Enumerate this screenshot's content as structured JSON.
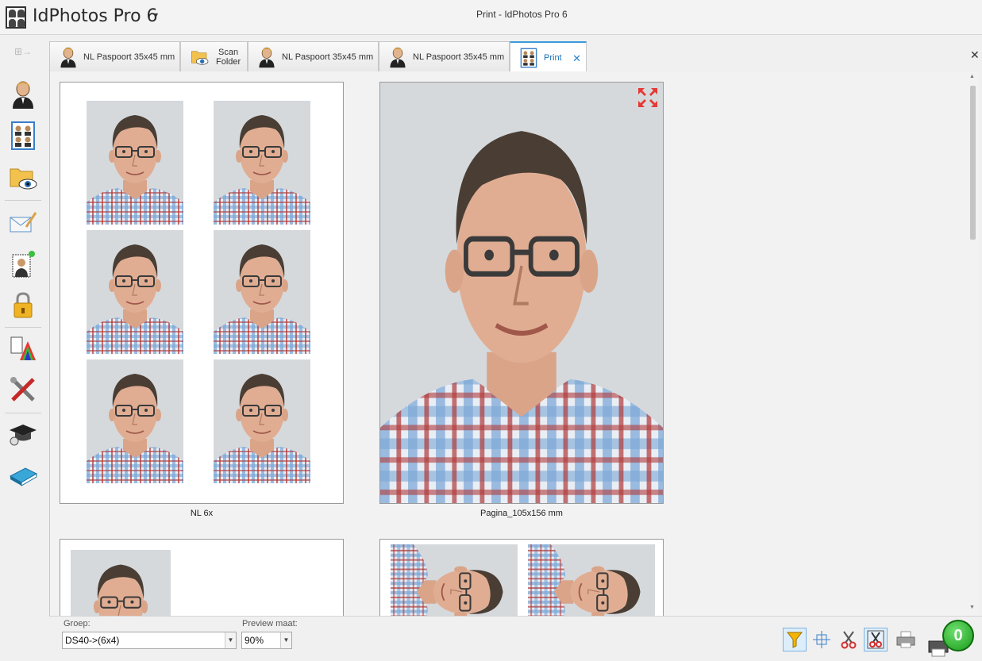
{
  "app": {
    "name": "IdPhotos Pro 6",
    "window_title": "Print - IdPhotos Pro 6"
  },
  "tabs": [
    {
      "label": "NL Paspoort 35x45 mm",
      "icon": "person-icon"
    },
    {
      "label_line1": "Scan",
      "label_line2": "Folder",
      "icon": "scan-folder-icon"
    },
    {
      "label": "NL Paspoort 35x45 mm",
      "icon": "person-icon"
    },
    {
      "label": "NL Paspoort 35x45 mm",
      "icon": "person-icon"
    },
    {
      "label": "Print",
      "icon": "print-sheet-icon",
      "active": true
    }
  ],
  "sheets": [
    {
      "caption": "NL 6x"
    },
    {
      "caption": "Pagina_105x156 mm"
    }
  ],
  "bottom": {
    "group_label": "Groep:",
    "group_value": "DS40->(6x4)",
    "preview_label": "Preview maat:",
    "preview_value": "90%",
    "counter": "0"
  },
  "colors": {
    "accent": "#3a9bd9",
    "badge_green": "#189a18"
  }
}
